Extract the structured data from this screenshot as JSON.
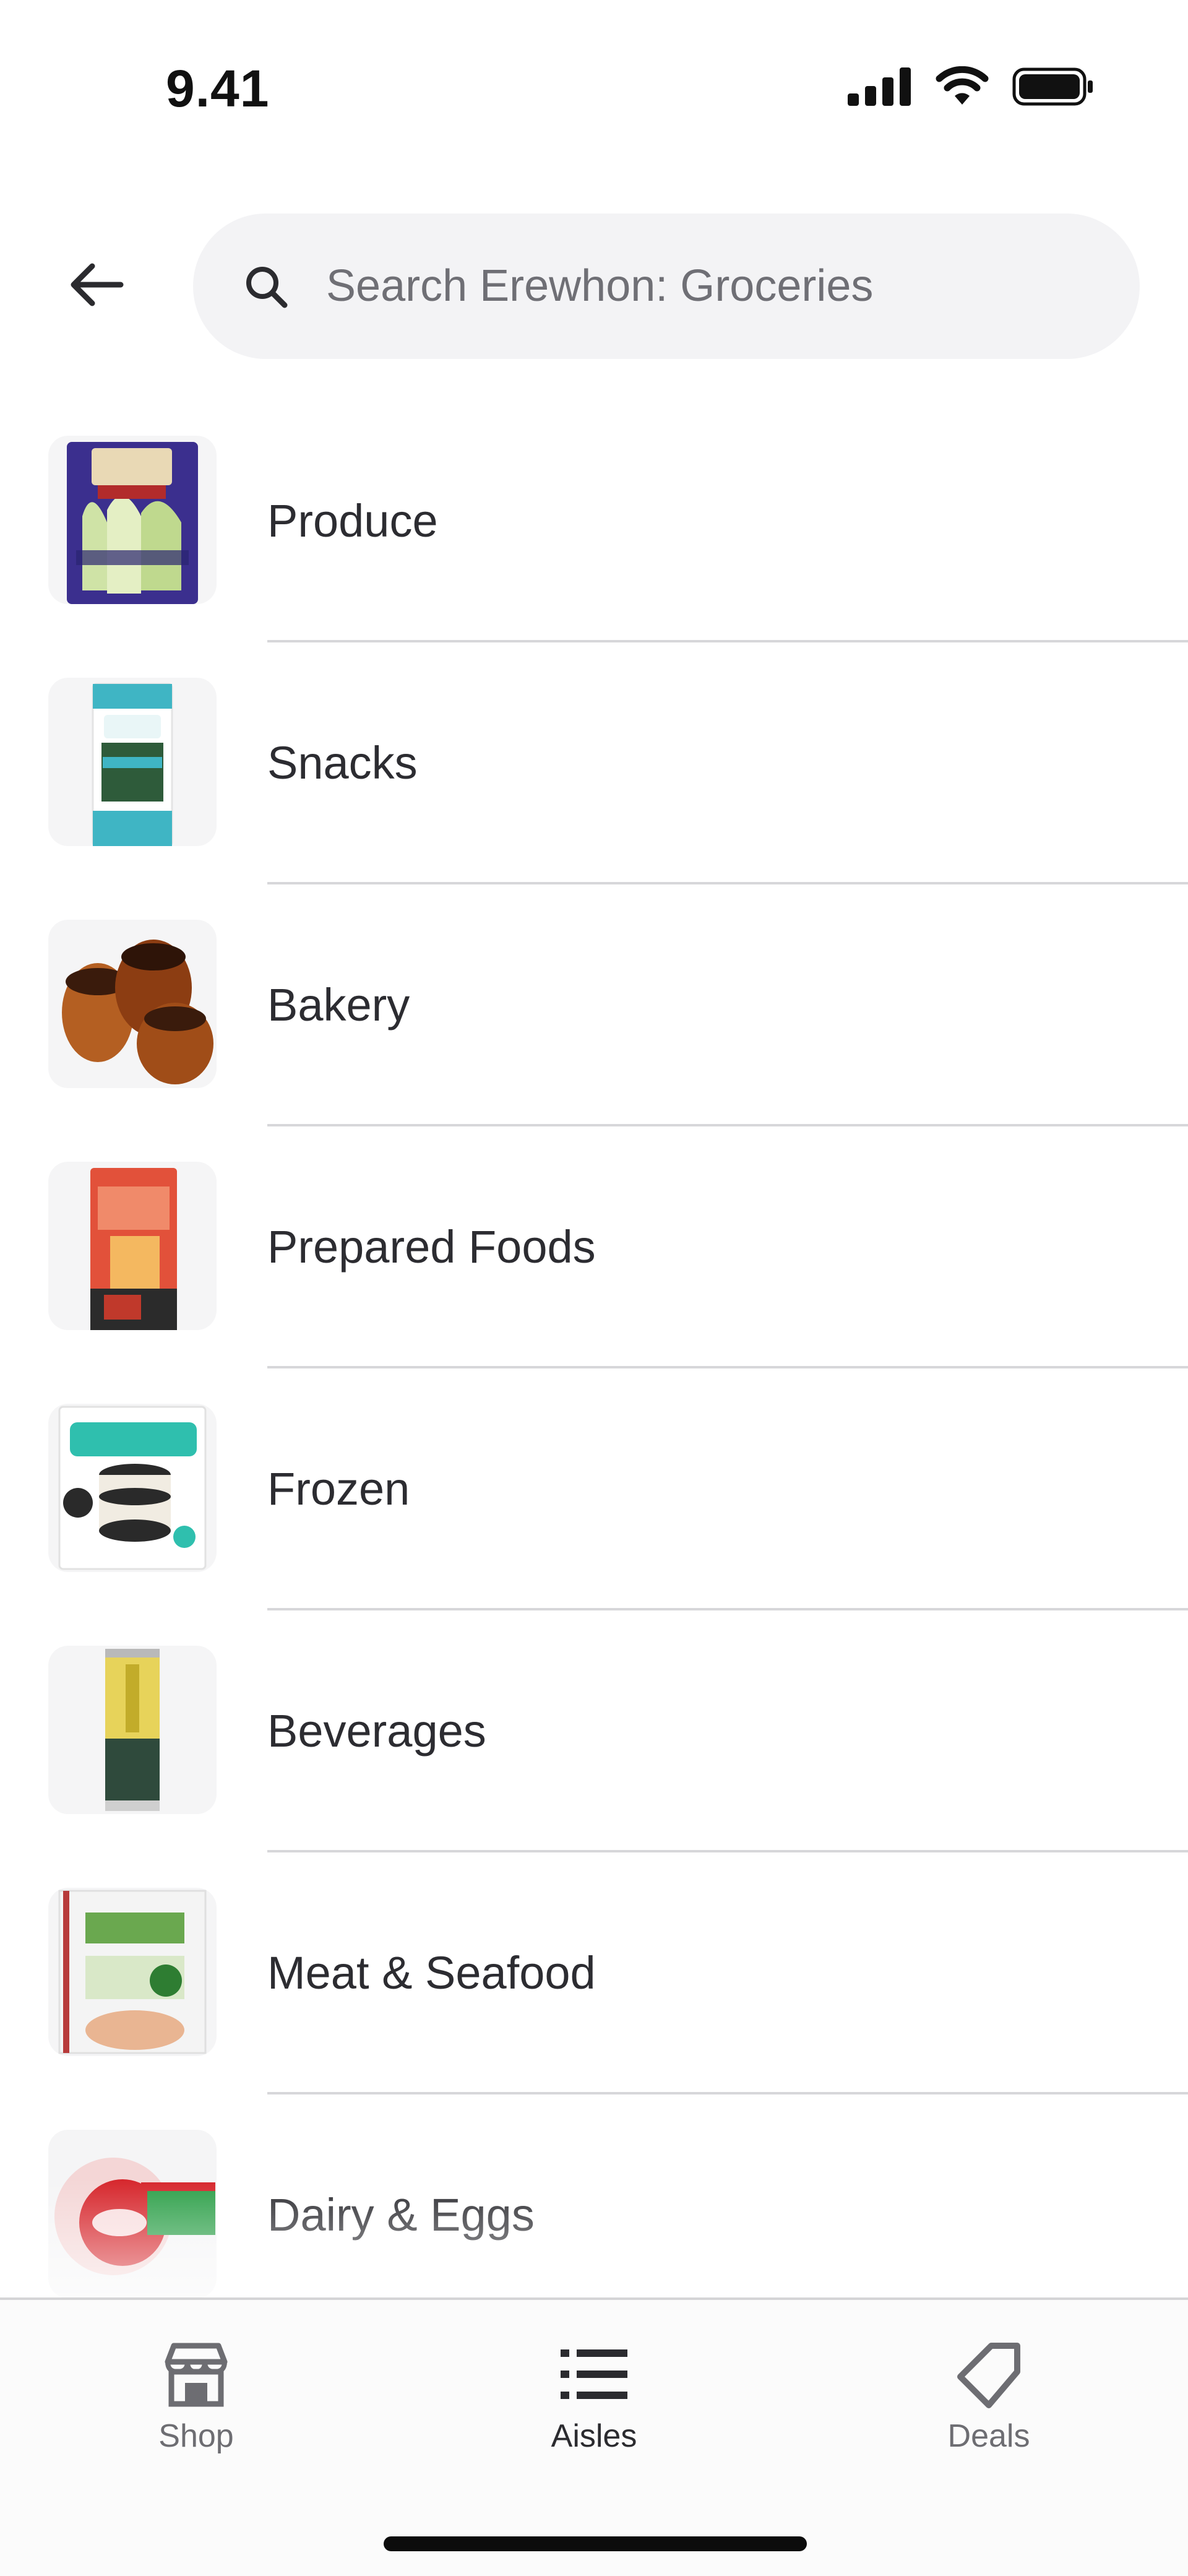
{
  "status_bar": {
    "time": "9.41",
    "icons": [
      "cellular-signal-icon",
      "wifi-icon",
      "battery-icon"
    ]
  },
  "header": {
    "back_icon": "arrow-left-icon",
    "search": {
      "icon": "search-icon",
      "placeholder": "Search Erewhon: Groceries"
    }
  },
  "aisles": [
    {
      "label": "Produce",
      "image": "romaine-hearts-package"
    },
    {
      "label": "Snacks",
      "image": "gimme-seaweed-package"
    },
    {
      "label": "Bakery",
      "image": "canele-pastries"
    },
    {
      "label": "Prepared Foods",
      "image": "rice-ramen-package"
    },
    {
      "label": "Frozen",
      "image": "goodpop-ice-cream-sandwiches"
    },
    {
      "label": "Beverages",
      "image": "beverage-can"
    },
    {
      "label": "Meat & Seafood",
      "image": "smoked-turkey-breast-package"
    },
    {
      "label": "Dairy & Eggs",
      "image": "babybel-cheese-package"
    }
  ],
  "bottom_nav": {
    "items": [
      {
        "label": "Shop",
        "icon": "storefront-icon",
        "active": false
      },
      {
        "label": "Aisles",
        "icon": "list-icon",
        "active": true
      },
      {
        "label": "Deals",
        "icon": "tag-icon",
        "active": false
      }
    ]
  },
  "colors": {
    "text_primary": "#2b2b2f",
    "text_secondary": "#6d6d72",
    "search_bg": "#f3f3f5",
    "divider": "#d7d7da"
  }
}
